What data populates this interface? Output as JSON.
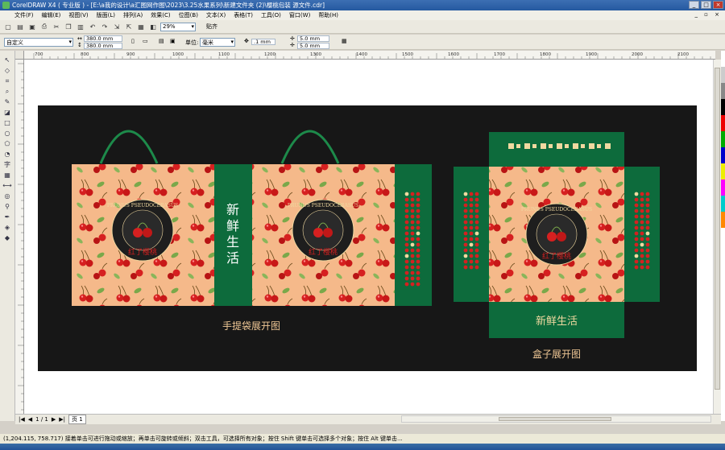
{
  "window": {
    "title": "CorelDRAW X4 ( 专业版 ) - [E:\\a我的设计\\a汇图网作图\\2023\\3.25水果系列\\新建文件夹 (2)\\樱桃包装 源文件.cdr]",
    "buttons": [
      "_",
      "□",
      "×"
    ]
  },
  "menu": {
    "items": [
      "文件(F)",
      "编辑(E)",
      "视图(V)",
      "版面(L)",
      "排列(A)",
      "效果(C)",
      "位图(B)",
      "文本(X)",
      "表格(T)",
      "工具(O)",
      "窗口(W)",
      "帮助(H)"
    ],
    "right_controls": "_ ▫ ×"
  },
  "toolbar": {
    "zoom": "29%",
    "snap_label": "贴齐"
  },
  "property_bar": {
    "preset": "自定义",
    "width": "380.0 mm",
    "height": "380.0 mm",
    "units_label": "单位:",
    "units_value": "毫米",
    "nudge": ".1 mm",
    "dup_x": "5.0 mm",
    "dup_y": "5.0 mm"
  },
  "ruler": {
    "h_ticks": [
      "700",
      "800",
      "900",
      "1000",
      "1100",
      "1200",
      "1300",
      "1400",
      "1500",
      "1600",
      "1700",
      "1800",
      "1900",
      "2000",
      "2100"
    ],
    "unit": "毫米"
  },
  "artwork": {
    "bag_text_vertical": [
      "新",
      "鲜",
      "生",
      "活"
    ],
    "logo_ring_text": "PRUNUS PSEUDOCERASUS",
    "logo_brand": "红了樱桃",
    "bag_caption": "手提袋展开图",
    "box_slogan": "新鲜生活",
    "box_caption": "盒子展开图",
    "colors": {
      "background": "#171717",
      "peach": "#f5b98a",
      "green": "#0d6b3c",
      "cherry": "#d62020",
      "gold": "#f0d9a0"
    }
  },
  "pagebar": {
    "page_count": "1 / 1",
    "page_tab": "页 1"
  },
  "status": {
    "text": "(1,204.115, 758.717) 接着单击可进行拖动或缩放；再单击可旋转或倾斜；双击工具，可选择所有对象；按住 Shift 键单击可选择多个对象；按住 Alt 键单击..."
  }
}
